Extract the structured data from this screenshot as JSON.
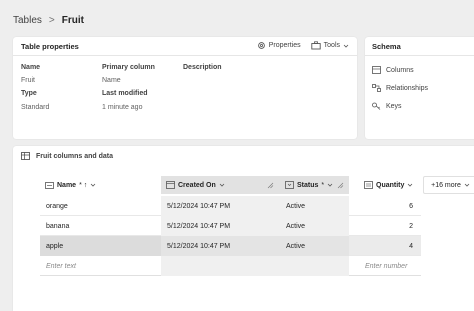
{
  "breadcrumb": {
    "parent": "Tables",
    "separator": ">",
    "current": "Fruit"
  },
  "properties": {
    "title": "Table properties",
    "tools": {
      "properties_label": "Properties",
      "tools_label": "Tools"
    },
    "labels": {
      "name": "Name",
      "primary_column": "Primary column",
      "description": "Description",
      "type": "Type",
      "last_modified": "Last modified"
    },
    "values": {
      "name": "Fruit",
      "primary_column": "Name",
      "type": "Standard",
      "last_modified": "1 minute ago"
    }
  },
  "schema": {
    "title": "Schema",
    "items": [
      "Columns",
      "Relationships",
      "Keys"
    ]
  },
  "table": {
    "title": "Fruit columns and data",
    "columns": [
      {
        "label": "Name",
        "suffix": "* ↑",
        "icon": "text-column-icon"
      },
      {
        "label": "Created On",
        "suffix": "",
        "icon": "calendar-column-icon"
      },
      {
        "label": "Status",
        "suffix": "*",
        "icon": "choice-column-icon"
      },
      {
        "label": "Quantity",
        "suffix": "",
        "icon": "number-column-icon"
      }
    ],
    "more_columns": "+16 more",
    "rows": [
      {
        "name": "orange",
        "created": "5/12/2024 10:47 PM",
        "status": "Active",
        "quantity": "6"
      },
      {
        "name": "banana",
        "created": "5/12/2024 10:47 PM",
        "status": "Active",
        "quantity": "2"
      },
      {
        "name": "apple",
        "created": "5/12/2024 10:47 PM",
        "status": "Active",
        "quantity": "4"
      }
    ],
    "new_row": {
      "text_placeholder": "Enter text",
      "number_placeholder": "Enter number"
    }
  }
}
